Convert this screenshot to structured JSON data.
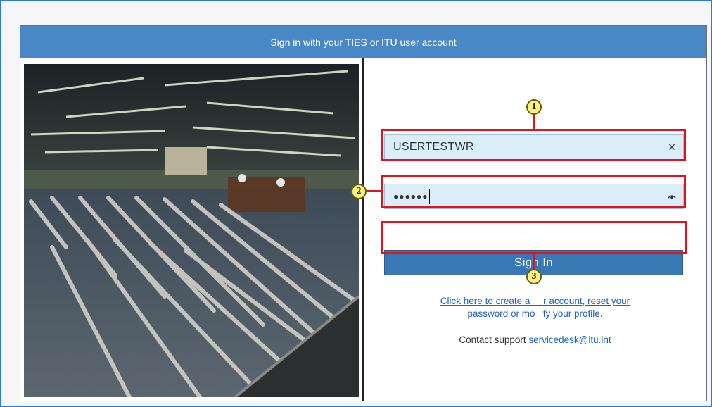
{
  "dialog": {
    "title": "Sign in with your TIES or ITU user account"
  },
  "form": {
    "username_value": "USERTESTWR",
    "password_value": "●●●●●●",
    "clear_icon": "×",
    "signin_label": "Sign In",
    "link_line1": "Click here to create a ITU account, reset your",
    "link_line1_a": "Click here to create a",
    "link_line1_b": "r account, reset your",
    "link_line2_a": "password or mo",
    "link_line2_b": "fy your profile.",
    "contact_label": "Contact support",
    "contact_email": "servicedesk@itu.int"
  },
  "annotations": {
    "callout_1": "1",
    "callout_2": "2",
    "callout_3": "3"
  },
  "colors": {
    "header": "#4a87c7",
    "button": "#3a78b5",
    "field": "#d9eef9",
    "highlight": "#e0141e",
    "callout": "#fff27a",
    "link": "#1d63c2"
  },
  "icons": {
    "clear": "close-icon",
    "reveal": "eye-icon"
  }
}
